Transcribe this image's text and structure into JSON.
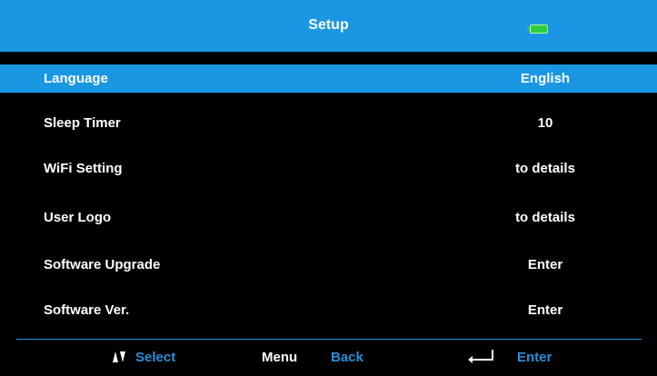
{
  "header": {
    "title": "Setup",
    "battery_icon": "battery-full-icon",
    "battery_color": "#2ecc40",
    "accent_color": "#1a97e3"
  },
  "menu": {
    "items": [
      {
        "label": "Language",
        "value": "English",
        "selected": true
      },
      {
        "label": "Sleep Timer",
        "value": "10",
        "selected": false
      },
      {
        "label": "WiFi Setting",
        "value": "to details",
        "selected": false
      },
      {
        "label": "User Logo",
        "value": "to details",
        "selected": false
      },
      {
        "label": "Software Upgrade",
        "value": "Enter",
        "selected": false
      },
      {
        "label": "Software Ver.",
        "value": "Enter",
        "selected": false
      }
    ]
  },
  "footer": {
    "select_icon": "up-down-arrows-icon",
    "select_label": "Select",
    "menu_key": "Menu",
    "back_label": "Back",
    "enter_icon": "enter-return-icon",
    "enter_label": "Enter"
  }
}
